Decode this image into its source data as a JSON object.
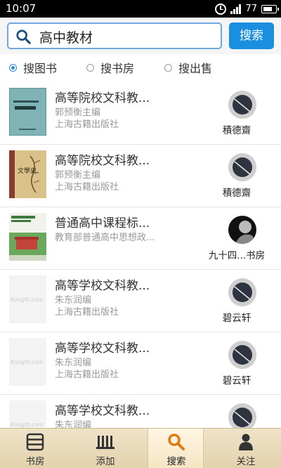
{
  "status_bar": {
    "time": "10:07",
    "battery": "77"
  },
  "search": {
    "query": "高中教材",
    "button_label": "搜索"
  },
  "search_modes": [
    {
      "label": "搜图书",
      "selected": true
    },
    {
      "label": "搜书房",
      "selected": false
    },
    {
      "label": "搜出售",
      "selected": false
    }
  ],
  "results": [
    {
      "title": "高等院校文科教...",
      "author": "郭预衡主编",
      "publisher": "上海古籍出版社",
      "shop": "積德齋"
    },
    {
      "title": "高等院校文科教...",
      "author": "郭预衡主编",
      "publisher": "上海古籍出版社",
      "shop": "積德齋"
    },
    {
      "title": "普通高中课程标...",
      "author": "教育部普通高中思想政...",
      "publisher": "",
      "shop": "九十四...书房"
    },
    {
      "title": "高等学校文科教...",
      "author": "朱东润编",
      "publisher": "上海古籍出版社",
      "shop": "碧云轩"
    },
    {
      "title": "高等学校文科教...",
      "author": "朱东润编",
      "publisher": "上海古籍出版社",
      "shop": "碧云轩"
    },
    {
      "title": "高等学校文科教...",
      "author": "朱东润编",
      "publisher": "",
      "shop": ""
    }
  ],
  "covers": {
    "watermark": "Kongfz.com",
    "book2_title": "文學史"
  },
  "bottom_nav": [
    {
      "label": "书房",
      "icon": "bookshelf-icon",
      "active": false
    },
    {
      "label": "添加",
      "icon": "add-books-icon",
      "active": false
    },
    {
      "label": "搜索",
      "icon": "search-icon",
      "active": true
    },
    {
      "label": "关注",
      "icon": "person-icon",
      "active": false
    }
  ],
  "colors": {
    "accent": "#1a8fdf",
    "nav_bg": "#e9dab8"
  }
}
